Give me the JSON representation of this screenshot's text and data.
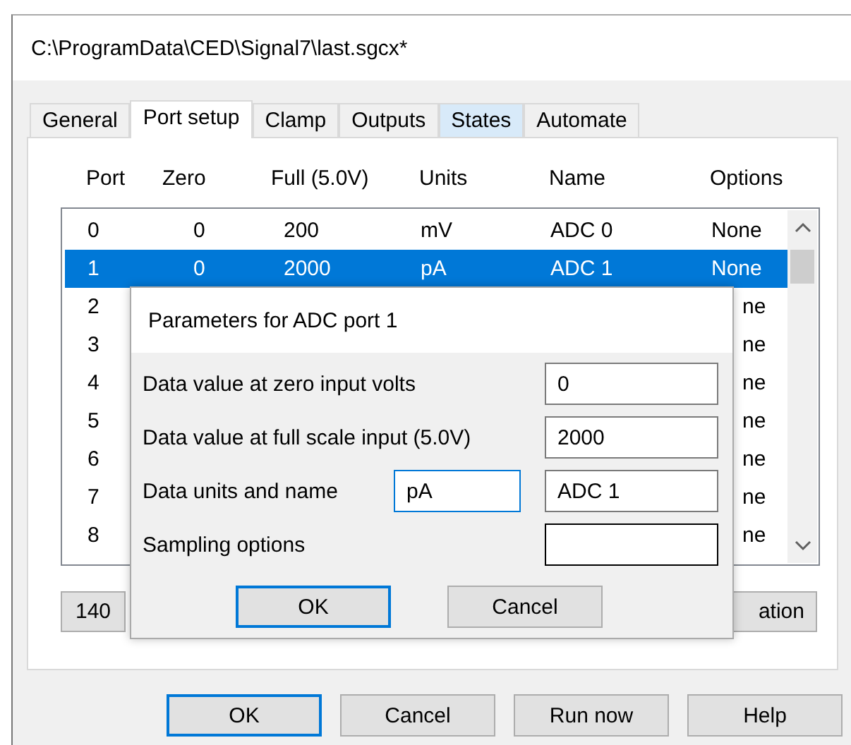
{
  "window": {
    "title": "C:\\ProgramData\\CED\\Signal7\\last.sgcx*"
  },
  "tabs": [
    {
      "label": "General",
      "selected": false,
      "hovered": false
    },
    {
      "label": "Port setup",
      "selected": true,
      "hovered": false
    },
    {
      "label": "Clamp",
      "selected": false,
      "hovered": false
    },
    {
      "label": "Outputs",
      "selected": false,
      "hovered": false
    },
    {
      "label": "States",
      "selected": false,
      "hovered": true
    },
    {
      "label": "Automate",
      "selected": false,
      "hovered": false
    }
  ],
  "table": {
    "columns": [
      "Port",
      "Zero",
      "Full (5.0V)",
      "Units",
      "Name",
      "Options"
    ],
    "rows": [
      {
        "port": "0",
        "zero": "0",
        "full": "200",
        "units": "mV",
        "name": "ADC 0",
        "options": "None",
        "selected": false
      },
      {
        "port": "1",
        "zero": "0",
        "full": "2000",
        "units": "pA",
        "name": "ADC 1",
        "options": "None",
        "selected": true
      },
      {
        "port": "2",
        "options": "ne",
        "selected": false
      },
      {
        "port": "3",
        "options": "ne",
        "selected": false
      },
      {
        "port": "4",
        "options": "ne",
        "selected": false
      },
      {
        "port": "5",
        "options": "ne",
        "selected": false
      },
      {
        "port": "6",
        "options": "ne",
        "selected": false
      },
      {
        "port": "7",
        "options": "ne",
        "selected": false
      },
      {
        "port": "8",
        "options": "ne",
        "selected": false
      }
    ]
  },
  "panel_buttons": [
    "140",
    "ation"
  ],
  "dialog": {
    "title": "Parameters for ADC port 1",
    "fields": [
      {
        "label": "Data value at zero input volts",
        "value": "0"
      },
      {
        "label": "Data value at full scale input (5.0V)",
        "value": "2000"
      },
      {
        "label": "Data units and name",
        "unit_value": "pA",
        "value": "ADC 1"
      },
      {
        "label": "Sampling options"
      }
    ],
    "buttons": [
      {
        "label": "OK",
        "default": true
      },
      {
        "label": "Cancel",
        "default": false
      }
    ]
  },
  "buttons": [
    {
      "label": "OK",
      "default": true
    },
    {
      "label": "Cancel",
      "default": false
    },
    {
      "label": "Run now",
      "default": false
    },
    {
      "label": "Help",
      "default": false
    }
  ]
}
